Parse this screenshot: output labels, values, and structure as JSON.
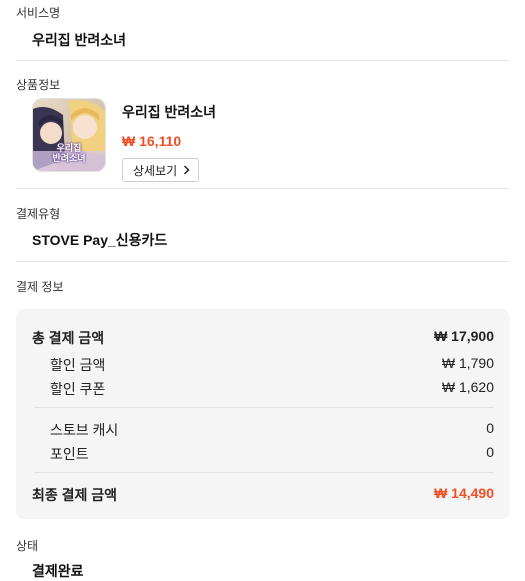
{
  "service": {
    "label": "서비스명",
    "value": "우리집 반려소녀"
  },
  "product": {
    "label": "상품정보",
    "name": "우리집 반려소녀",
    "price": "₩ 16,110",
    "detail_button": "상세보기",
    "thumb_logo_line1": "우리집",
    "thumb_logo_line2": "반려소녀"
  },
  "payment_type": {
    "label": "결제유형",
    "value": "STOVE Pay_신용카드"
  },
  "payment_info": {
    "label": "결제 정보",
    "total_label": "총 결제 금액",
    "total_value": "₩ 17,900",
    "discount_label": "할인 금액",
    "discount_value": "₩ 1,790",
    "coupon_label": "할인 쿠폰",
    "coupon_value": "₩ 1,620",
    "cash_label": "스토브 캐시",
    "cash_value": "0",
    "point_label": "포인트",
    "point_value": "0",
    "final_label": "최종 결제 금액",
    "final_value": "₩ 14,490"
  },
  "status": {
    "label": "상태",
    "value": "결제완료"
  },
  "colors": {
    "accent": "#f04e23",
    "box_bg": "#f5f5f5"
  }
}
